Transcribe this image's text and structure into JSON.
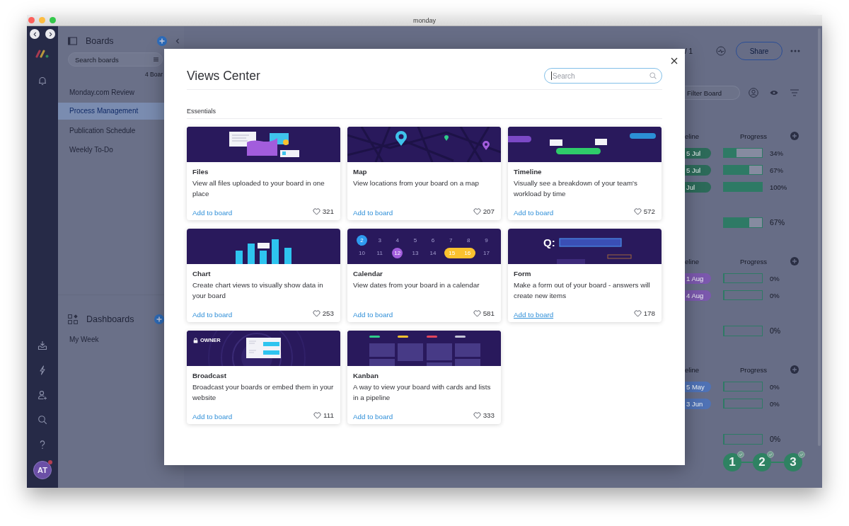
{
  "window": {
    "title": "monday"
  },
  "nav_rail": {
    "avatar": "AT",
    "notification": true
  },
  "sidebar": {
    "boards": {
      "title": "Boards",
      "search": {
        "placeholder": "Search boards"
      },
      "count": "4 Boar",
      "items": [
        {
          "label": "Monday.com Review",
          "selected": false
        },
        {
          "label": "Process Management",
          "selected": true
        },
        {
          "label": "Publication Schedule",
          "selected": false
        },
        {
          "label": "Weekly To-Do",
          "selected": false
        }
      ]
    },
    "dashboards": {
      "title": "Dashboards",
      "items": [
        {
          "label": "My Week",
          "selected": false
        }
      ]
    }
  },
  "board": {
    "count": "/ 1",
    "share": "Share",
    "filter": {
      "placeholder": "Filter Board"
    },
    "groups": [
      {
        "column_1": "eline",
        "column_2": "Progress",
        "rows": [
          {
            "timeline": "5 Jul",
            "color": "#2c6a59",
            "level": 0.34,
            "reading": "34%"
          },
          {
            "timeline": "5 Jul",
            "color": "#2c6a59",
            "level": 0.67,
            "reading": "67%"
          },
          {
            "timeline": "Jul",
            "color": "#2c6a59",
            "level": 1,
            "reading": "100%"
          }
        ],
        "summary": {
          "level": 0.67,
          "reading": "67%"
        }
      },
      {
        "column_1": "eline",
        "column_2": "Progress",
        "rows": [
          {
            "timeline": "1 Aug",
            "color": "#7b58ad",
            "level": 0,
            "reading": "0%"
          },
          {
            "timeline": "4 Aug",
            "color": "#7b58ad",
            "level": 0,
            "reading": "0%"
          }
        ],
        "summary": {
          "level": 0,
          "reading": "0%"
        }
      },
      {
        "column_1": "eline",
        "column_2": "Progress",
        "rows": [
          {
            "timeline": "5 May",
            "color": "#4f72b5",
            "level": 0,
            "reading": "0%"
          },
          {
            "timeline": "3 Jun",
            "color": "#4f72b5",
            "level": 0,
            "reading": "0%"
          }
        ],
        "summary": {
          "level": 0,
          "reading": "0%"
        }
      }
    ],
    "steps": [
      {
        "label": "1",
        "done": true
      },
      {
        "label": "2",
        "done": true
      },
      {
        "label": "3",
        "done": true
      }
    ]
  },
  "modal": {
    "title": "Views Center",
    "search": {
      "placeholder": "Search",
      "focused": true
    },
    "section": "Essentials",
    "cards": [
      {
        "kind": "files",
        "title": "Files",
        "description": "View all files uploaded to your board in one place",
        "action": "Add to board",
        "hovered": false,
        "likes": "321"
      },
      {
        "kind": "map",
        "title": "Map",
        "description": "View locations from your board on a map",
        "action": "Add to board",
        "hovered": false,
        "likes": "207"
      },
      {
        "kind": "timeline",
        "title": "Timeline",
        "description": "Visually see a breakdown of your team's workload by time",
        "action": "Add to board",
        "hovered": false,
        "likes": "572"
      },
      {
        "kind": "chart",
        "title": "Chart",
        "description": "Create chart views to visually show data in your board",
        "action": "Add to board",
        "hovered": false,
        "likes": "253"
      },
      {
        "kind": "calendar",
        "title": "Calendar",
        "description": "View dates from your board in a calendar",
        "action": "Add to board",
        "hovered": false,
        "likes": "581",
        "weeks": [
          {
            "days": [
              {
                "label": "2",
                "color": "#2e9bef"
              },
              {
                "label": "3"
              },
              {
                "label": "4"
              },
              {
                "label": "5"
              },
              {
                "label": "6"
              },
              {
                "label": "7"
              },
              {
                "label": "8"
              },
              {
                "label": "9"
              }
            ]
          },
          {
            "days": [
              {
                "label": "10"
              },
              {
                "label": "11"
              },
              {
                "label": "12",
                "color": "#a25ddc"
              },
              {
                "label": "13"
              },
              {
                "label": "14"
              },
              {
                "label": "15",
                "color": "#fbc22e"
              },
              {
                "label": "16",
                "color": "#fbc22e"
              },
              {
                "label": "17"
              }
            ]
          }
        ]
      },
      {
        "kind": "form",
        "title": "Form",
        "description": "Make a form out of your board - answers will create new items",
        "action": "Add to board",
        "hovered": true,
        "likes": "178",
        "prompt": "Q:"
      },
      {
        "kind": "broadcast",
        "title": "Broadcast",
        "description": "Broadcast your boards or embed them in your website",
        "action": "Add to board",
        "hovered": false,
        "likes": "111",
        "badge": "OWNER"
      },
      {
        "kind": "kanban",
        "title": "Kanban",
        "description": "A way to view your board with cards and lists in a pipeline",
        "action": "Add to board",
        "hovered": false,
        "likes": "333"
      }
    ]
  }
}
